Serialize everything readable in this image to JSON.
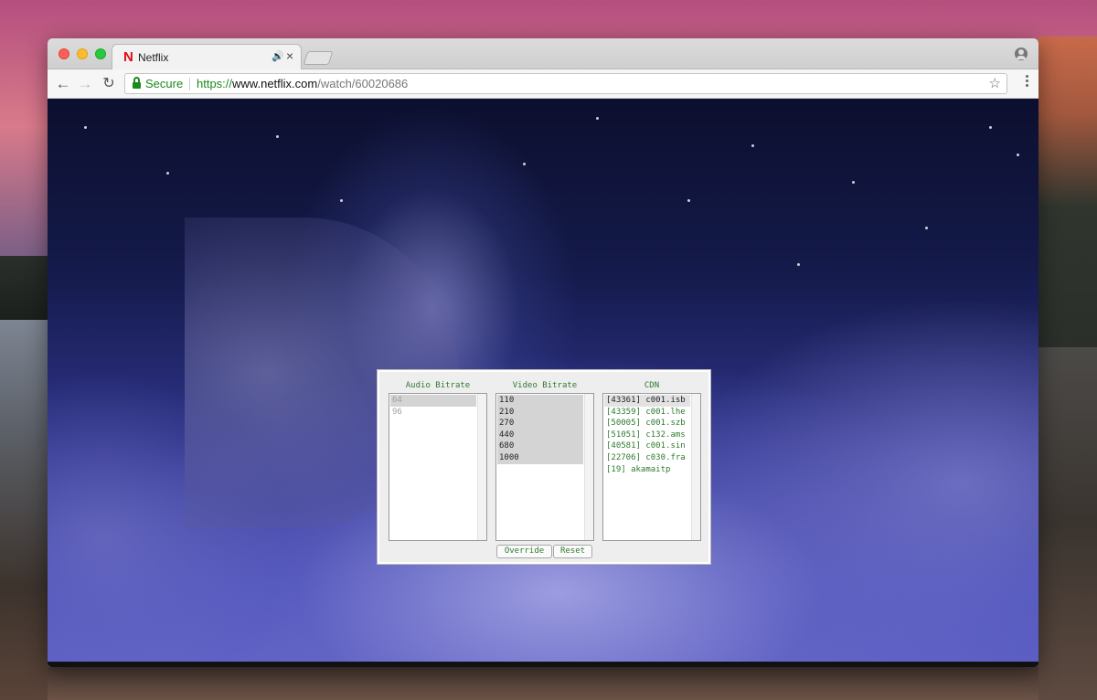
{
  "browser": {
    "tab": {
      "logo": "N",
      "title": "Netflix",
      "audio_icon": "🔊",
      "close_icon": "×"
    },
    "address": {
      "secure_label": "Secure",
      "scheme": "https://",
      "host": "www.netflix.com",
      "path": "/watch/60020686"
    },
    "icons": {
      "back": "arrow-left-icon",
      "forward": "arrow-right-icon",
      "reload": "reload-icon",
      "lock": "lock-icon",
      "star": "bookmark-star-icon",
      "menu": "kebab-menu-icon",
      "profile": "profile-icon"
    }
  },
  "stream_manager": {
    "audio": {
      "label": "Audio Bitrate",
      "options": [
        "64",
        "96"
      ],
      "selected": [
        "64"
      ]
    },
    "video": {
      "label": "Video Bitrate",
      "options": [
        "110",
        "210",
        "270",
        "440",
        "680",
        "1000"
      ],
      "selected": [
        "110",
        "210",
        "270",
        "440",
        "680",
        "1000"
      ]
    },
    "cdn": {
      "label": "CDN",
      "options": [
        "[43361] c001.isb",
        "[43359] c001.lhe",
        "[50005] c001.szb",
        "[51051] c132.ams",
        "[40581] c001.sin",
        "[22706] c030.fra",
        "[19] akamaitp"
      ],
      "selected": [
        "[43361] c001.isb"
      ]
    },
    "buttons": {
      "override": "Override",
      "reset": "Reset"
    }
  },
  "colors": {
    "secure_green": "#1a8a1a",
    "panel_text_green": "#2f7a2f",
    "netflix_red": "#e50914"
  }
}
